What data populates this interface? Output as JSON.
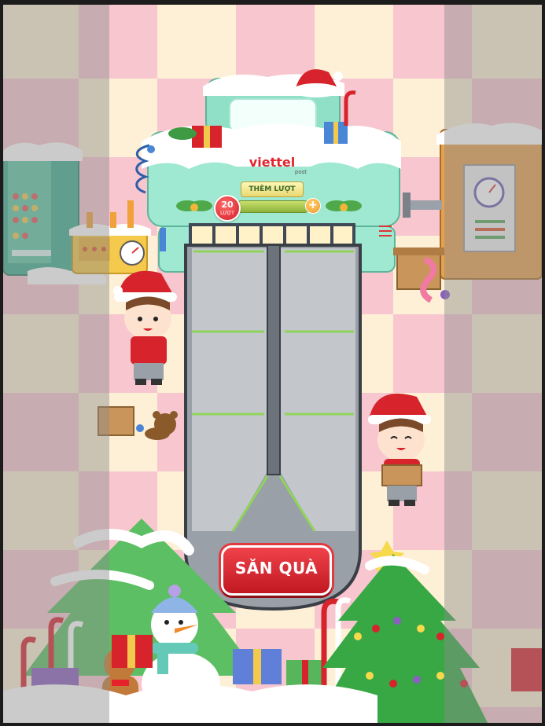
{
  "game": {
    "brand_name": "viettel",
    "brand_sub": "post",
    "more_turns_label": "THÊM LƯỢT",
    "turns_count": "20",
    "turns_unit": "LƯỢT",
    "plus_symbol": "+",
    "hunt_button_label": "SĂN QUÀ"
  },
  "icons": [
    "santa-hat-icon",
    "gift-box-icon",
    "candy-cane-icon",
    "snowman-icon",
    "christmas-tree-icon",
    "gingerbread-icon",
    "teddy-bear-icon",
    "gauge-icon"
  ],
  "colors": {
    "brand_red": "#e1242d",
    "machine_mint": "#8fe0c6",
    "button_red": "#d6232c",
    "checker_pink": "#f7c6cf",
    "checker_cream": "#fdf0d6"
  }
}
